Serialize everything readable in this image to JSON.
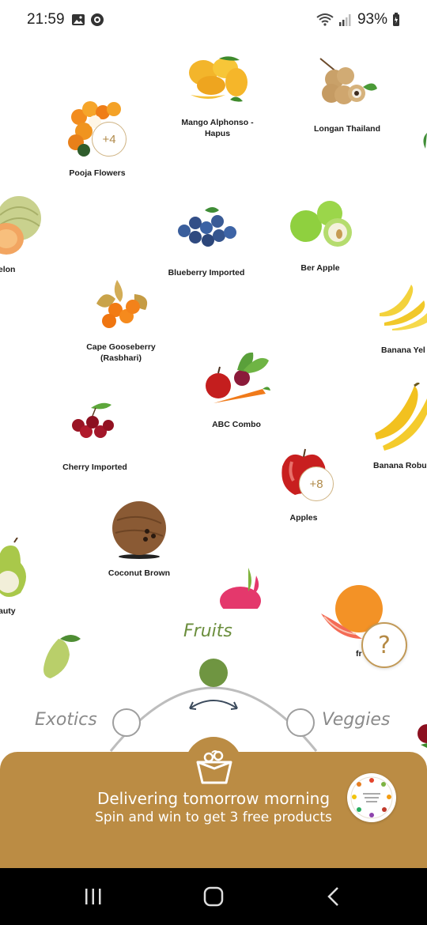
{
  "status_bar": {
    "time": "21:59",
    "battery": "93%"
  },
  "products": {
    "mango": "Mango Alphonso -\nHapus",
    "longan": "Longan Thailand",
    "pooja": "Pooja Flowers",
    "pooja_badge": "+4",
    "muskmelon": "melon",
    "blueberry": "Blueberry Imported",
    "ber": "Ber Apple",
    "gooseberry": "Cape Gooseberry\n(Rasbhari)",
    "banana_yelakki": "Banana Yel",
    "abc": "ABC Combo",
    "cherry": "Cherry Imported",
    "banana_robusta": "Banana Robus",
    "apples": "Apples",
    "apples_badge": "+8",
    "coconut": "Coconut Brown",
    "pear": "auty",
    "grapefruit": "fr"
  },
  "categories": {
    "active": "Fruits",
    "left": "Exotics",
    "right": "Veggies"
  },
  "help_label": "?",
  "banner": {
    "title": "Delivering tomorrow morning",
    "subtitle": "Spin and win to get 3 free products",
    "color": "#bb8c44"
  },
  "colors": {
    "accent_green": "#6b8e3d",
    "gold": "#c29a58"
  }
}
